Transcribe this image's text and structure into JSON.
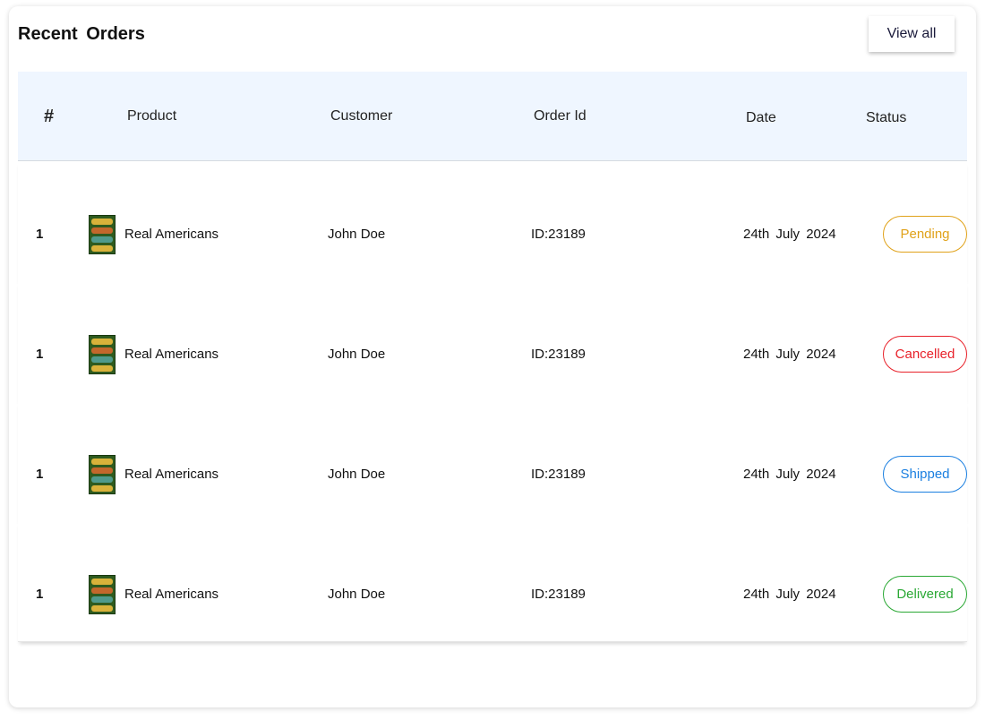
{
  "header": {
    "title": "Recent  Orders",
    "view_all_label": "View all"
  },
  "table": {
    "columns": [
      "#",
      "Product",
      "Customer",
      "Order Id",
      "Date",
      "Status"
    ],
    "rows": [
      {
        "num": "1",
        "product": "Real Americans",
        "customer": "John Doe",
        "order_id": "ID:23189",
        "date": "24th  July 2024",
        "status": "Pending",
        "status_color": "#e0a21a"
      },
      {
        "num": "1",
        "product": "Real Americans",
        "customer": "John Doe",
        "order_id": "ID:23189",
        "date": "24th  July 2024",
        "status": "Cancelled",
        "status_color": "#e8212a"
      },
      {
        "num": "1",
        "product": "Real Americans",
        "customer": "John Doe",
        "order_id": "ID:23189",
        "date": "24th  July 2024",
        "status": "Shipped",
        "status_color": "#1b7fe0"
      },
      {
        "num": "1",
        "product": "Real Americans",
        "customer": "John Doe",
        "order_id": "ID:23189",
        "date": "24th  July 2024",
        "status": "Delivered",
        "status_color": "#2aa834"
      }
    ]
  },
  "colors": {
    "header_bg": "#eff6ff",
    "text": "#111111"
  }
}
